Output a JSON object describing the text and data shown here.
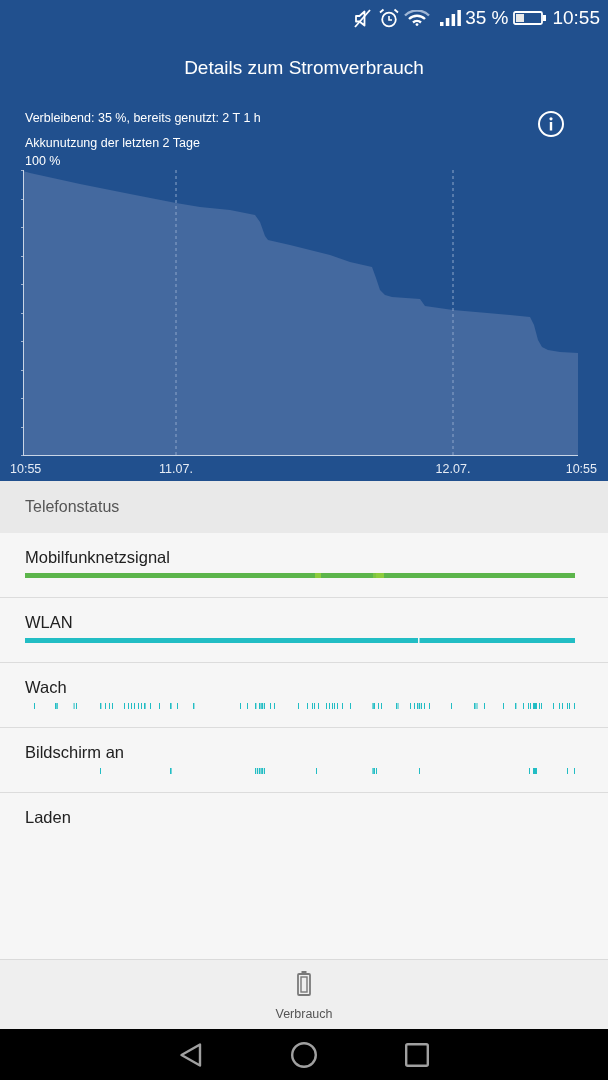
{
  "status_bar": {
    "battery_text": "35 %",
    "time": "10:55"
  },
  "header": {
    "title": "Details zum Stromverbrauch"
  },
  "summary": {
    "text": "Verbleibend: 35 %, bereits genutzt: 2 T 1 h"
  },
  "chart": {
    "title": "Akkunutzung der letzten 2 Tage",
    "top_label": "100 %",
    "x_labels": [
      "10:55",
      "11.07.",
      "12.07.",
      "10:55"
    ]
  },
  "section": {
    "title": "Telefonstatus"
  },
  "rows": [
    {
      "label": "Mobilfunknetzsignal",
      "kind": "signal"
    },
    {
      "label": "WLAN",
      "kind": "wifi"
    },
    {
      "label": "Wach",
      "kind": "awake"
    },
    {
      "label": "Bildschirm an",
      "kind": "screen"
    },
    {
      "label": "Laden",
      "kind": "empty"
    }
  ],
  "bottom_nav": {
    "label": "Verbrauch"
  }
}
